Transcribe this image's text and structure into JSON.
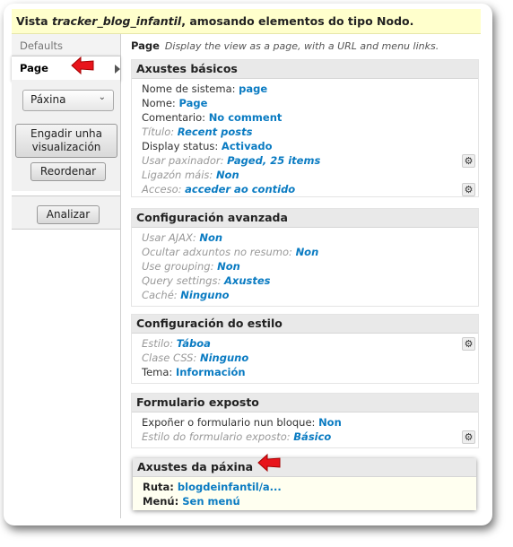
{
  "header": {
    "prefix": "Vista ",
    "view_name": "tracker_blog_infantil",
    "suffix": ", amosando elementos do tipo Nodo."
  },
  "sidebar": {
    "defaults_label": "Defaults",
    "page_label": "Page",
    "display_select": "Páxina",
    "add_display_button": "Engadir unha visualización",
    "reorder_button": "Reordenar",
    "analyze_button": "Analizar"
  },
  "page_header": {
    "title": "Page",
    "description": "Display the view as a page, with a URL and menu links."
  },
  "panels": {
    "basic": {
      "title": "Axustes básicos",
      "rows": [
        {
          "label": "Nome de sistema:",
          "value": "page",
          "dim": false,
          "gear": false
        },
        {
          "label": "Nome:",
          "value": "Page",
          "dim": false,
          "gear": false
        },
        {
          "label": "Comentario:",
          "value": "No comment",
          "dim": false,
          "gear": false
        },
        {
          "label": "Título:",
          "value": "Recent posts",
          "dim": true,
          "gear": false
        },
        {
          "label": "Display status:",
          "value": "Activado",
          "dim": false,
          "gear": false
        },
        {
          "label": "Usar paxinador:",
          "value": "Paged, 25 items",
          "dim": true,
          "gear": true
        },
        {
          "label": "Ligazón máis:",
          "value": "Non",
          "dim": true,
          "gear": false
        },
        {
          "label": "Acceso:",
          "value": "acceder ao contido",
          "dim": true,
          "gear": true
        }
      ]
    },
    "advanced": {
      "title": "Configuración avanzada",
      "rows": [
        {
          "label": "Usar AJAX:",
          "value": "Non",
          "dim": true,
          "gear": false
        },
        {
          "label": "Ocultar adxuntos no resumo:",
          "value": "Non",
          "dim": true,
          "gear": false
        },
        {
          "label": "Use grouping:",
          "value": "Non",
          "dim": true,
          "gear": false
        },
        {
          "label": "Query settings:",
          "value": "Axustes",
          "dim": true,
          "gear": false
        },
        {
          "label": "Caché:",
          "value": "Ninguno",
          "dim": true,
          "gear": false
        }
      ]
    },
    "style": {
      "title": "Configuración do estilo",
      "rows": [
        {
          "label": "Estilo:",
          "value": "Táboa",
          "dim": true,
          "gear": true
        },
        {
          "label": "Clase CSS:",
          "value": "Ninguno",
          "dim": true,
          "gear": false
        },
        {
          "label": "Tema:",
          "value": "Información",
          "dim": false,
          "gear": false
        }
      ]
    },
    "exposed": {
      "title": "Formulario exposto",
      "rows": [
        {
          "label": "Expoñer o formulario nun bloque:",
          "value": "Non",
          "dim": false,
          "gear": false
        },
        {
          "label": "Estilo do formulario exposto:",
          "value": "Básico",
          "dim": true,
          "gear": true
        }
      ]
    },
    "page_settings": {
      "title": "Axustes da páxina",
      "rows": [
        {
          "label": "Ruta:",
          "value": "blogdeinfantil/a..."
        },
        {
          "label": "Menú:",
          "value": "Sen menú"
        }
      ]
    }
  },
  "icons": {
    "gear": "gear-icon",
    "annotation": "red-arrow-icon",
    "chevron": "chevron-down-icon"
  },
  "colors": {
    "link": "#0a7bc2",
    "header_bg": "#ffffcc",
    "annotation": "#e8141b"
  }
}
